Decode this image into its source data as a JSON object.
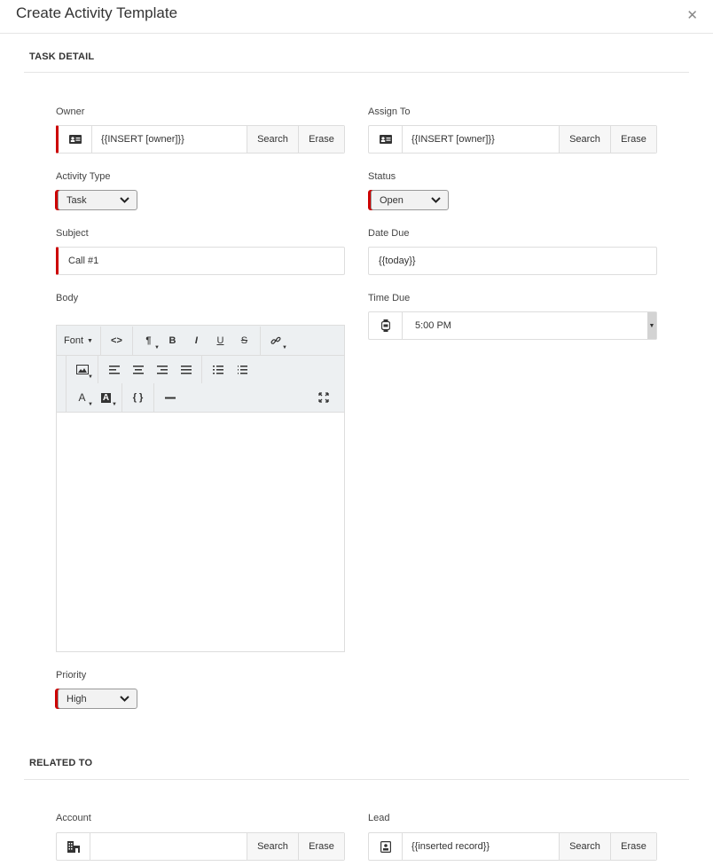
{
  "dialog": {
    "title": "Create Activity Template",
    "close_icon": "close-icon"
  },
  "sections": {
    "task_detail": "TASK DETAIL",
    "related_to": "RELATED TO"
  },
  "fields": {
    "owner": {
      "label": "Owner",
      "value": "{{INSERT [owner]}}",
      "search": "Search",
      "erase": "Erase",
      "icon": "contact-card-icon",
      "required": true
    },
    "assign_to": {
      "label": "Assign To",
      "value": "{{INSERT [owner]}}",
      "search": "Search",
      "erase": "Erase",
      "icon": "contact-card-icon",
      "required": false
    },
    "activity_type": {
      "label": "Activity Type",
      "value": "Task",
      "required": true
    },
    "status": {
      "label": "Status",
      "value": "Open",
      "required": true
    },
    "subject": {
      "label": "Subject",
      "value": "Call #1",
      "required": true
    },
    "date_due": {
      "label": "Date Due",
      "value": "{{today}}"
    },
    "body": {
      "label": "Body",
      "value": ""
    },
    "time_due": {
      "label": "Time Due",
      "value": "5:00 PM",
      "icon": "watch-icon"
    },
    "priority": {
      "label": "Priority",
      "value": "High",
      "required": true
    },
    "account": {
      "label": "Account",
      "value": "",
      "search": "Search",
      "erase": "Erase",
      "icon": "building-icon"
    },
    "lead": {
      "label": "Lead",
      "value": "{{inserted record}}",
      "search": "Search",
      "erase": "Erase",
      "icon": "contact-badge-icon"
    }
  },
  "editor_toolbar": {
    "font_label": "Font",
    "buttons": [
      "code-view",
      "paragraph",
      "bold",
      "italic",
      "underline",
      "strikethrough",
      "link",
      "image",
      "align-left",
      "align-center",
      "align-right",
      "justify",
      "bullet-list",
      "numbered-list",
      "font-color",
      "background-color",
      "template-variable",
      "horizontal-rule",
      "fullscreen"
    ]
  }
}
